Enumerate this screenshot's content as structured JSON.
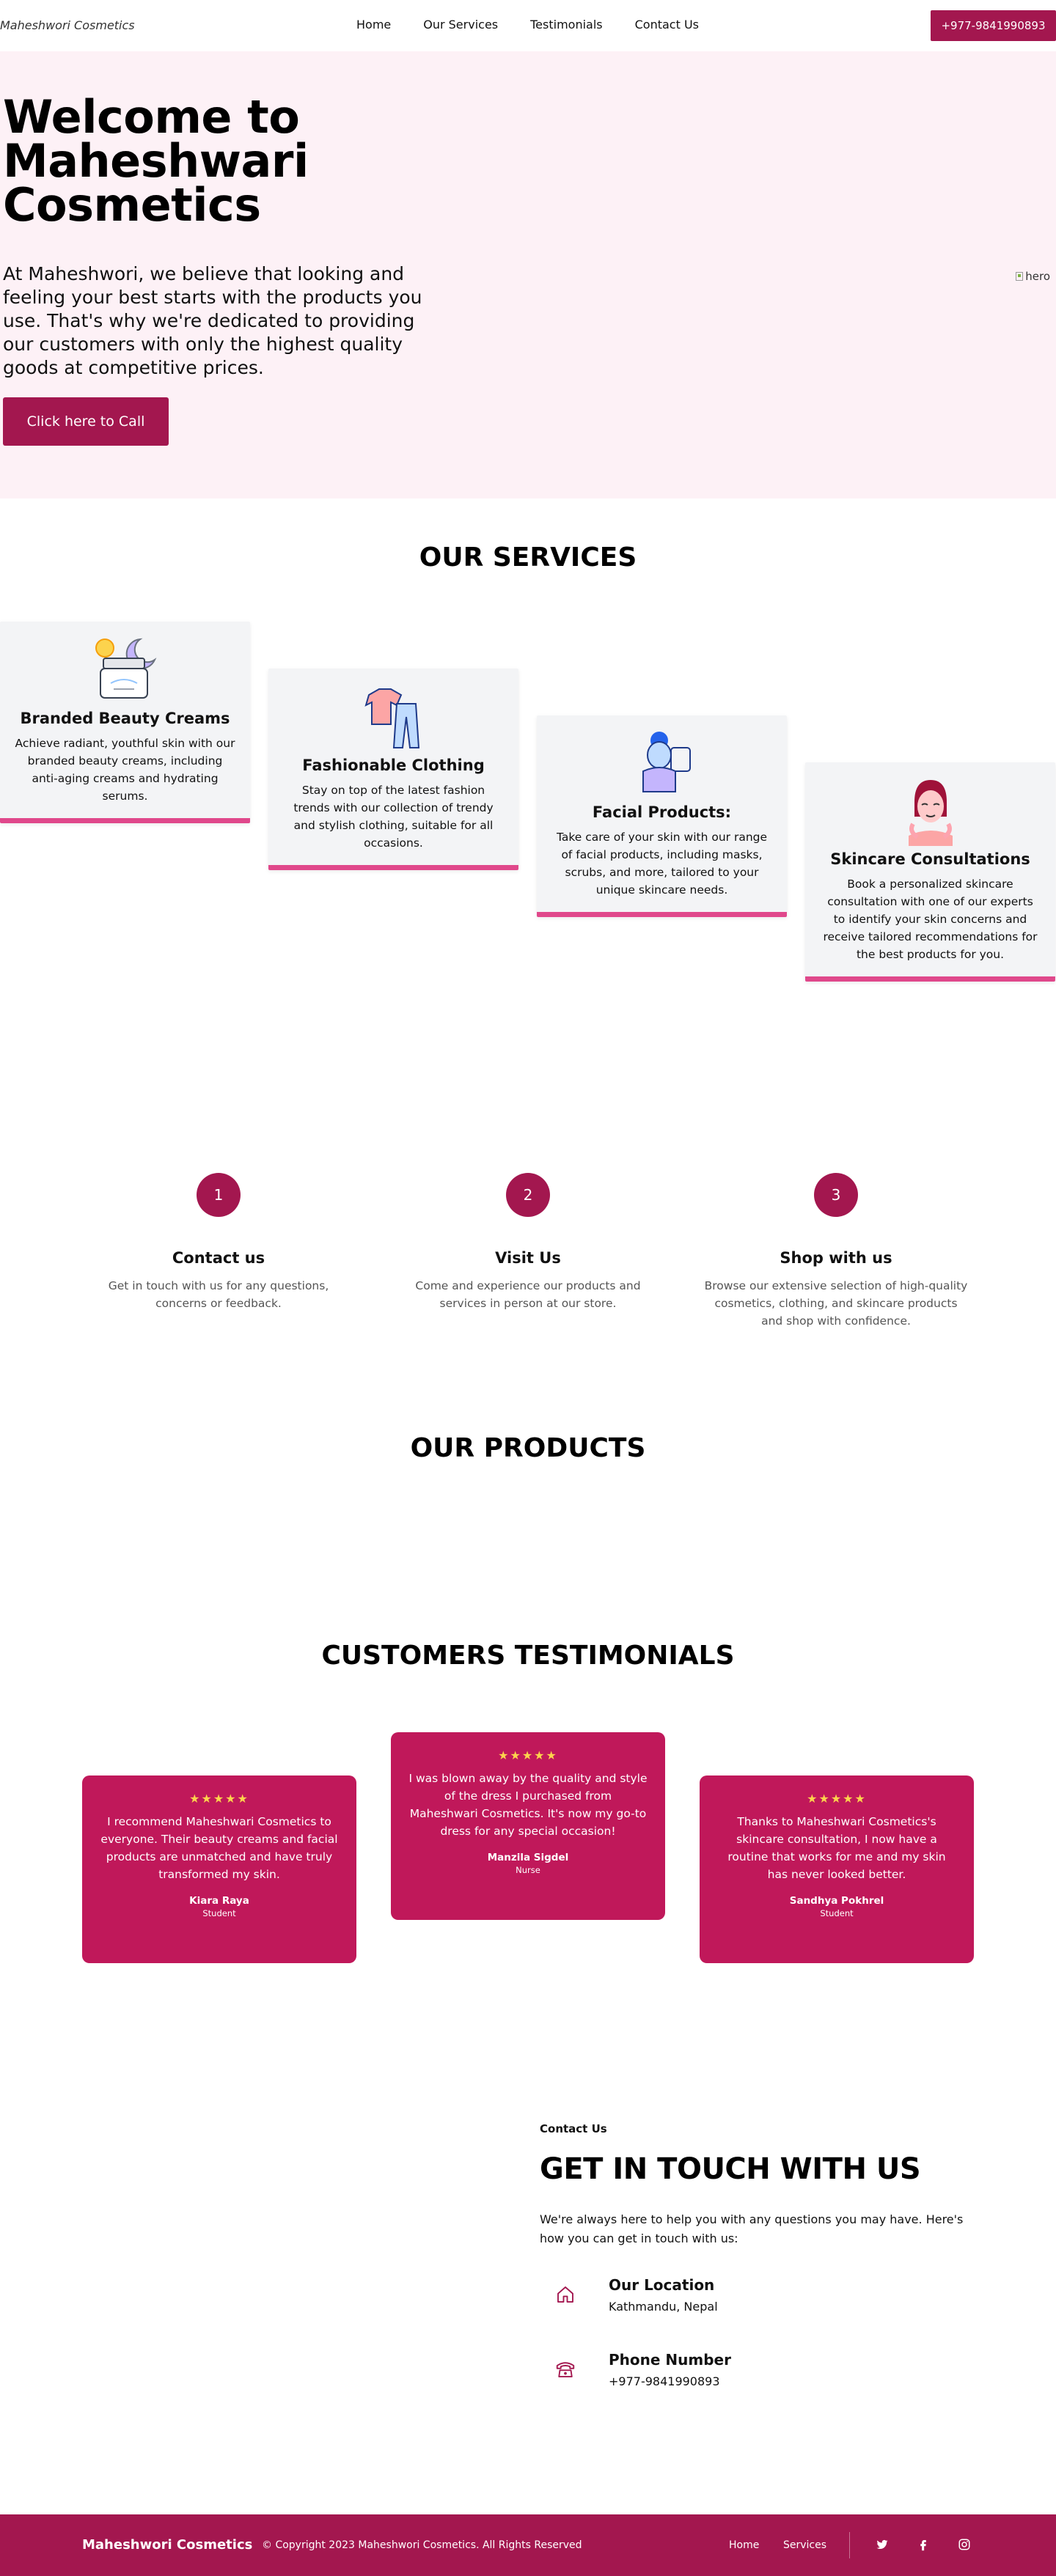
{
  "nav": {
    "brand": "Maheshwori Cosmetics",
    "links": [
      "Home",
      "Our Services",
      "Testimonials",
      "Contact Us"
    ],
    "phone": "+977-9841990893"
  },
  "hero": {
    "title": "Welcome to Maheshwari Cosmetics",
    "text": "At Maheshwori, we believe that looking and feeling your best starts with the products you use. That's why we're dedicated to providing our customers with only the highest quality goods at competitive prices.",
    "button": "Click here to Call",
    "image_alt": "hero"
  },
  "services": {
    "title": "OUR SERVICES",
    "items": [
      {
        "title": "Branded Beauty Creams",
        "desc": "Achieve radiant, youthful skin with our branded beauty creams, including anti-aging creams and hydrating serums.",
        "icon": "cream-jar-icon"
      },
      {
        "title": "Fashionable Clothing",
        "desc": "Stay on top of the latest fashion trends with our collection of trendy and stylish clothing, suitable for all occasions.",
        "icon": "clothing-icon"
      },
      {
        "title": "Facial Products:",
        "desc": "Take care of your skin with our range of facial products, including masks, scrubs, and more, tailored to your unique skincare needs.",
        "icon": "facial-icon"
      },
      {
        "title": "Skincare Consultations",
        "desc": "Book a personalized skincare consultation with one of our experts to identify your skin concerns and receive tailored recommendations for the best products for you.",
        "icon": "skincare-face-icon"
      }
    ]
  },
  "steps": [
    {
      "num": "1",
      "title": "Contact us",
      "desc": "Get in touch with us for any questions, concerns or feedback."
    },
    {
      "num": "2",
      "title": "Visit Us",
      "desc": "Come and experience our products and services in person at our store."
    },
    {
      "num": "3",
      "title": "Shop with us",
      "desc": "Browse our extensive selection of high-quality cosmetics, clothing, and skincare products and shop with confidence."
    }
  ],
  "products": {
    "title": "OUR PRODUCTS"
  },
  "testimonials": {
    "title": "CUSTOMERS TESTIMONIALS",
    "items": [
      {
        "stars": "★★★★★",
        "quote": "I recommend Maheshwari Cosmetics to everyone. Their beauty creams and facial products are unmatched and have truly transformed my skin.",
        "name": "Kiara Raya",
        "role": "Student"
      },
      {
        "stars": "★★★★★",
        "quote": "I was blown away by the quality and style of the dress I purchased from Maheshwari Cosmetics. It's now my go-to dress for any special occasion!",
        "name": "Manzila Sigdel",
        "role": "Nurse"
      },
      {
        "stars": "★★★★★",
        "quote": "Thanks to Maheshwari Cosmetics's skincare consultation, I now have a routine that works for me and my skin has never looked better.",
        "name": "Sandhya Pokhrel",
        "role": "Student"
      }
    ]
  },
  "contact": {
    "small": "Contact Us",
    "title": "GET IN TOUCH WITH US",
    "desc": "We're always here to help you with any questions you may have. Here's how you can get in touch with us:",
    "location_title": "Our Location",
    "location_value": "Kathmandu, Nepal",
    "phone_title": "Phone Number",
    "phone_value": "+977-9841990893"
  },
  "footer": {
    "brand": "Maheshwori Cosmetics",
    "copyright": "© Copyright 2023 Maheshwori Cosmetics. All Rights Reserved",
    "links": [
      "Home",
      "Services"
    ]
  },
  "colors": {
    "brand": "#a3174f",
    "testimonial_card": "#c0185a",
    "accent": "#e0488b",
    "hero_bg": "#fdf1f6"
  }
}
